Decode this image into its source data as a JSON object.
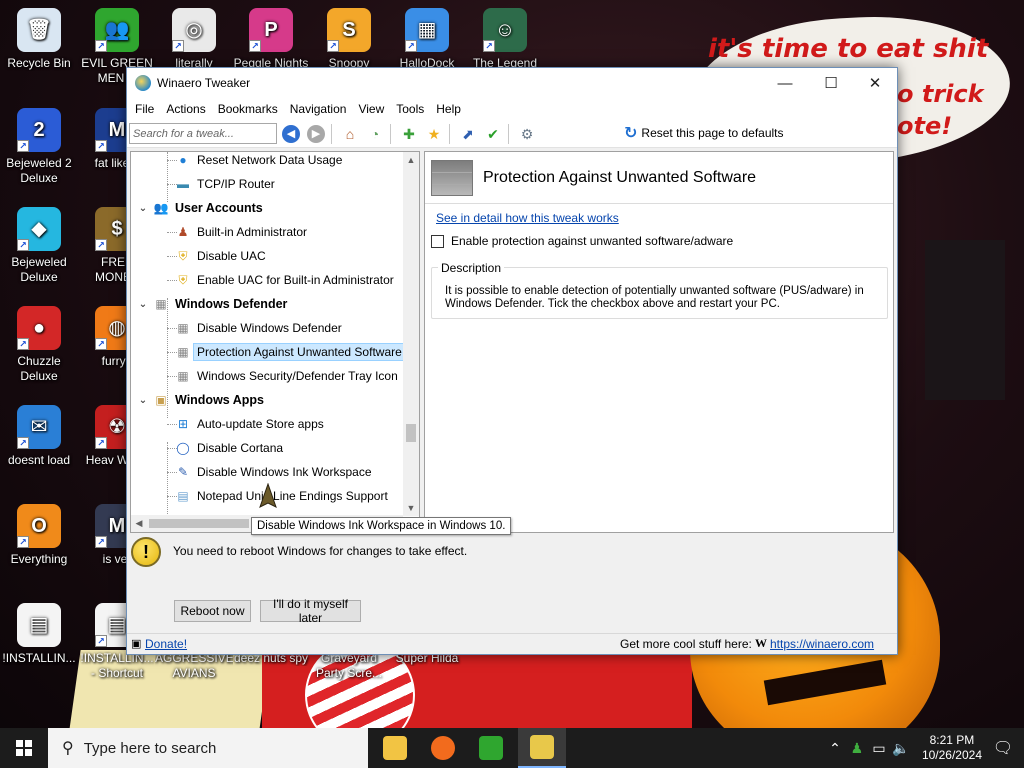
{
  "desktop": {
    "wallpaper_text": [
      "it's time to eat shit",
      "o trick",
      "ote!"
    ],
    "icons": [
      {
        "label": "Recycle Bin",
        "glyph": "🗑",
        "color": "#d9e6f2",
        "shortcut": false
      },
      {
        "label": "EVIL GREEN MEN C",
        "glyph": "👥",
        "color": "#2fa62f",
        "shortcut": true
      },
      {
        "label": "literally",
        "glyph": "◎",
        "color": "#e9e9e9",
        "shortcut": true
      },
      {
        "label": "Peggle Nights",
        "glyph": "P",
        "color": "#d63a8a",
        "shortcut": true
      },
      {
        "label": "Snoopy",
        "glyph": "S",
        "color": "#f3a72a",
        "shortcut": true
      },
      {
        "label": "HalloDock",
        "glyph": "▦",
        "color": "#3a8ee6",
        "shortcut": true
      },
      {
        "label": "The Legend",
        "glyph": "☺",
        "color": "#2d6b4a",
        "shortcut": true
      },
      {
        "label": "Bejeweled 2 Deluxe",
        "glyph": "2",
        "color": "#2b5cd6",
        "shortcut": true
      },
      {
        "label": "fat like d",
        "glyph": "M",
        "color": "#1c3d8f",
        "shortcut": true
      },
      {
        "label": "Bejeweled Deluxe",
        "glyph": "◆",
        "color": "#25b7e0",
        "shortcut": true
      },
      {
        "label": "FREE MONEY",
        "glyph": "$",
        "color": "#8b6a2a",
        "shortcut": true
      },
      {
        "label": "Chuzzle Deluxe",
        "glyph": "●",
        "color": "#d32727",
        "shortcut": true
      },
      {
        "label": "furryp",
        "glyph": "◍",
        "color": "#f07a17",
        "shortcut": true
      },
      {
        "label": "doesnt load",
        "glyph": "✉",
        "color": "#2a7fd6",
        "shortcut": true
      },
      {
        "label": "Heav Weap",
        "glyph": "☢",
        "color": "#c41f1f",
        "shortcut": true
      },
      {
        "label": "Everything",
        "glyph": "O",
        "color": "#f08a1a",
        "shortcut": true
      },
      {
        "label": "is ver",
        "glyph": "M",
        "color": "#333a52",
        "shortcut": true
      },
      {
        "label": "!INSTALLIN...",
        "glyph": "▤",
        "color": "#f4f4f4",
        "shortcut": false
      },
      {
        "label": "!INSTALLIN... - Shortcut",
        "glyph": "▤",
        "color": "#f4f4f4",
        "shortcut": true
      },
      {
        "label": "AGGRESSIVE AVIANS",
        "glyph": "",
        "color": "transparent",
        "shortcut": false
      },
      {
        "label": "deez nuts spy",
        "glyph": "",
        "color": "transparent",
        "shortcut": false
      },
      {
        "label": "Graveyard Party Scre...",
        "glyph": "",
        "color": "transparent",
        "shortcut": false
      },
      {
        "label": "Super Hilda",
        "glyph": "",
        "color": "transparent",
        "shortcut": false
      }
    ]
  },
  "window": {
    "title": "Winaero Tweaker",
    "controls": {
      "minimize": "—",
      "maximize": "☐",
      "close": "✕"
    },
    "menu": [
      "File",
      "Actions",
      "Bookmarks",
      "Navigation",
      "View",
      "Tools",
      "Help"
    ],
    "search_placeholder": "Search for a tweak...",
    "reset_label": "Reset this page to defaults",
    "tree": [
      {
        "type": "item",
        "label": "Reset Network Data Usage",
        "icon": "globe-icon",
        "glyph": "●",
        "color": "#1f7fd6"
      },
      {
        "type": "item",
        "label": "TCP/IP Router",
        "icon": "router-icon",
        "glyph": "▬",
        "color": "#3a8ab0"
      },
      {
        "type": "category",
        "label": "User Accounts",
        "icon": "users-icon",
        "glyph": "👥",
        "color": "#8a6a4a"
      },
      {
        "type": "item",
        "label": "Built-in Administrator",
        "icon": "admin-user-icon",
        "glyph": "♟",
        "color": "#b04a2a"
      },
      {
        "type": "item",
        "label": "Disable UAC",
        "icon": "uac-shield-icon",
        "glyph": "⛨",
        "color": "#e0b020"
      },
      {
        "type": "item",
        "label": "Enable UAC for Built-in Administrator",
        "icon": "uac-shield-icon",
        "glyph": "⛨",
        "color": "#e0b020"
      },
      {
        "type": "category",
        "label": "Windows Defender",
        "icon": "defender-wall-icon",
        "glyph": "▦",
        "color": "#888888"
      },
      {
        "type": "item",
        "label": "Disable Windows Defender",
        "icon": "wall-icon",
        "glyph": "▦",
        "color": "#888888"
      },
      {
        "type": "item",
        "label": "Protection Against Unwanted Software",
        "icon": "wall-icon",
        "glyph": "▦",
        "color": "#888888",
        "selected": true
      },
      {
        "type": "item",
        "label": "Windows Security/Defender Tray Icon",
        "icon": "wall-icon",
        "glyph": "▦",
        "color": "#888888"
      },
      {
        "type": "category",
        "label": "Windows Apps",
        "icon": "apps-icon",
        "glyph": "▣",
        "color": "#c8a050"
      },
      {
        "type": "item",
        "label": "Auto-update Store apps",
        "icon": "store-icon",
        "glyph": "⊞",
        "color": "#1f7fd6"
      },
      {
        "type": "item",
        "label": "Disable Cortana",
        "icon": "cortana-icon",
        "glyph": "◯",
        "color": "#1f5fc0"
      },
      {
        "type": "item",
        "label": "Disable Windows Ink Workspace",
        "icon": "pen-icon",
        "glyph": "✎",
        "color": "#3060b0"
      },
      {
        "type": "item",
        "label": "Notepad Unix Line Endings Support",
        "icon": "notepad-icon",
        "glyph": "▤",
        "color": "#6aa0d0"
      }
    ],
    "detail": {
      "title": "Protection Against Unwanted Software",
      "link": "See in detail how this tweak works",
      "option_label": "Enable protection against unwanted software/adware",
      "option_checked": false,
      "description_label": "Description",
      "description": "It is possible to enable detection of potentially unwanted software (PUS/adware) in Windows Defender. Tick the checkbox above and restart your PC."
    },
    "tooltip": "Disable Windows Ink Workspace in Windows 10.",
    "notice": "You need to reboot Windows for changes to take effect.",
    "reboot_now": "Reboot now",
    "reboot_later": "I'll do it myself later",
    "status_donate": "Donate!",
    "status_more": "Get more cool stuff here:",
    "status_url": "https://winaero.com"
  },
  "taskbar": {
    "search_placeholder": "Type here to search",
    "time": "8:21 PM",
    "date": "10/26/2024",
    "apps": [
      {
        "name": "file-explorer",
        "color": "#f2c443",
        "active": false
      },
      {
        "name": "firefox",
        "color": "#f26b1d",
        "active": false
      },
      {
        "name": "green-men",
        "color": "#2fa62f",
        "active": false
      },
      {
        "name": "winaero-tweaker",
        "color": "#e8c84a",
        "active": true
      }
    ]
  },
  "colors": {
    "selection_bg": "#cce8ff",
    "link": "#0645ad",
    "speech_text": "#d11a1a"
  }
}
